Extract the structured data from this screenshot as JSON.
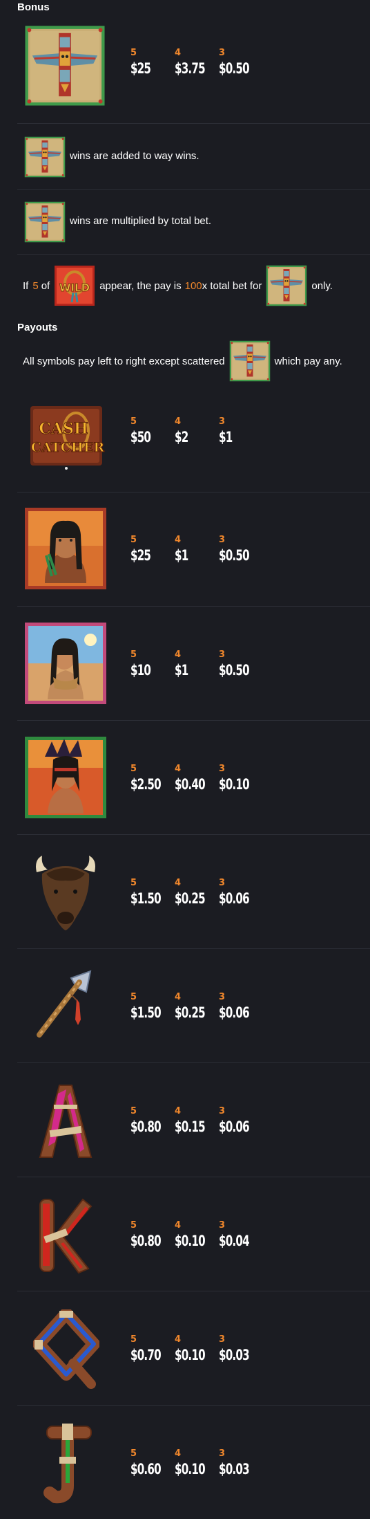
{
  "headings": {
    "bonus": "Bonus",
    "payouts": "Payouts"
  },
  "counts": {
    "c5": "5",
    "c4": "4",
    "c3": "3"
  },
  "bonus_pays": [
    "$25",
    "$3.75",
    "$0.50"
  ],
  "rules": {
    "added": "wins are added to way wins.",
    "multiplied": "wins are multiplied by total bet.",
    "five_pre": "If",
    "five_num": "5",
    "five_of": "of",
    "five_mid": "appear, the pay is",
    "five_mult": "100",
    "five_post": "x total bet for",
    "five_end": "only.",
    "scatter_pre": "All symbols pay left to right except scattered",
    "scatter_post": "which pay any."
  },
  "wild_label": "WILD",
  "logo_text": {
    "line1": "CASH",
    "line2": "CATCHER"
  },
  "symbols": [
    {
      "name": "cash-catcher",
      "pays": [
        "$50",
        "$2",
        "$1"
      ]
    },
    {
      "name": "chief",
      "pays": [
        "$25",
        "$1",
        "$0.50"
      ]
    },
    {
      "name": "maiden",
      "pays": [
        "$10",
        "$1",
        "$0.50"
      ]
    },
    {
      "name": "warrior",
      "pays": [
        "$2.50",
        "$0.40",
        "$0.10"
      ]
    },
    {
      "name": "buffalo",
      "pays": [
        "$1.50",
        "$0.25",
        "$0.06"
      ]
    },
    {
      "name": "tomahawk",
      "pays": [
        "$1.50",
        "$0.25",
        "$0.06"
      ]
    },
    {
      "name": "letter-a",
      "pays": [
        "$0.80",
        "$0.15",
        "$0.06"
      ]
    },
    {
      "name": "letter-k",
      "pays": [
        "$0.80",
        "$0.10",
        "$0.04"
      ]
    },
    {
      "name": "letter-q",
      "pays": [
        "$0.70",
        "$0.10",
        "$0.03"
      ]
    },
    {
      "name": "letter-j",
      "pays": [
        "$0.60",
        "$0.10",
        "$0.03"
      ]
    }
  ],
  "colors": {
    "accent": "#f0872c",
    "background": "#1b1c22",
    "divider": "#2c2e36"
  }
}
